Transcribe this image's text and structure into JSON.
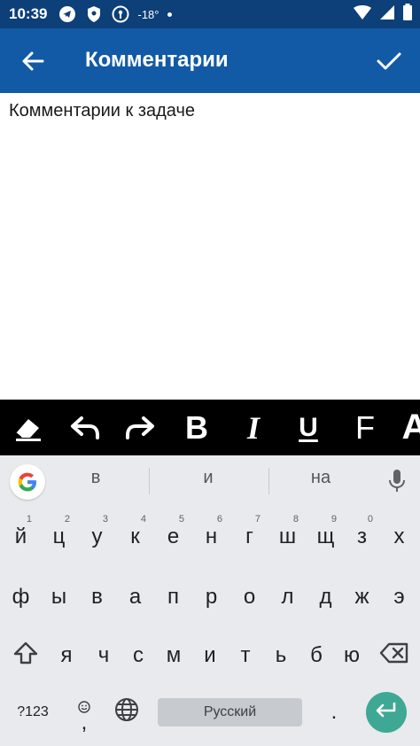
{
  "status_bar": {
    "time": "10:39",
    "temperature": "-18°"
  },
  "app_bar": {
    "title": "Комментарии"
  },
  "editor": {
    "text": "Комментарии к задаче"
  },
  "formatting_toolbar": {
    "bold": "B",
    "italic": "I",
    "underline": "U",
    "font": "F",
    "font_size": "A"
  },
  "keyboard": {
    "suggestions": [
      "в",
      "и",
      "на"
    ],
    "row1": [
      {
        "key": "й",
        "hint": "1"
      },
      {
        "key": "ц",
        "hint": "2"
      },
      {
        "key": "у",
        "hint": "3"
      },
      {
        "key": "к",
        "hint": "4"
      },
      {
        "key": "е",
        "hint": "5"
      },
      {
        "key": "н",
        "hint": "6"
      },
      {
        "key": "г",
        "hint": "7"
      },
      {
        "key": "ш",
        "hint": "8"
      },
      {
        "key": "щ",
        "hint": "9"
      },
      {
        "key": "з",
        "hint": "0"
      },
      {
        "key": "х",
        "hint": ""
      }
    ],
    "row2": [
      "ф",
      "ы",
      "в",
      "а",
      "п",
      "р",
      "о",
      "л",
      "д",
      "ж",
      "э"
    ],
    "row3": [
      "я",
      "ч",
      "с",
      "м",
      "и",
      "т",
      "ь",
      "б",
      "ю"
    ],
    "symbols_label": "?123",
    "comma_label": ",",
    "space_label": "Русский",
    "period_label": "."
  },
  "colors": {
    "status_bar": "#0d3f78",
    "app_bar": "#125aa5",
    "toolbar": "#000000",
    "keyboard": "#e8eaed",
    "enter_key": "#3ea894"
  }
}
